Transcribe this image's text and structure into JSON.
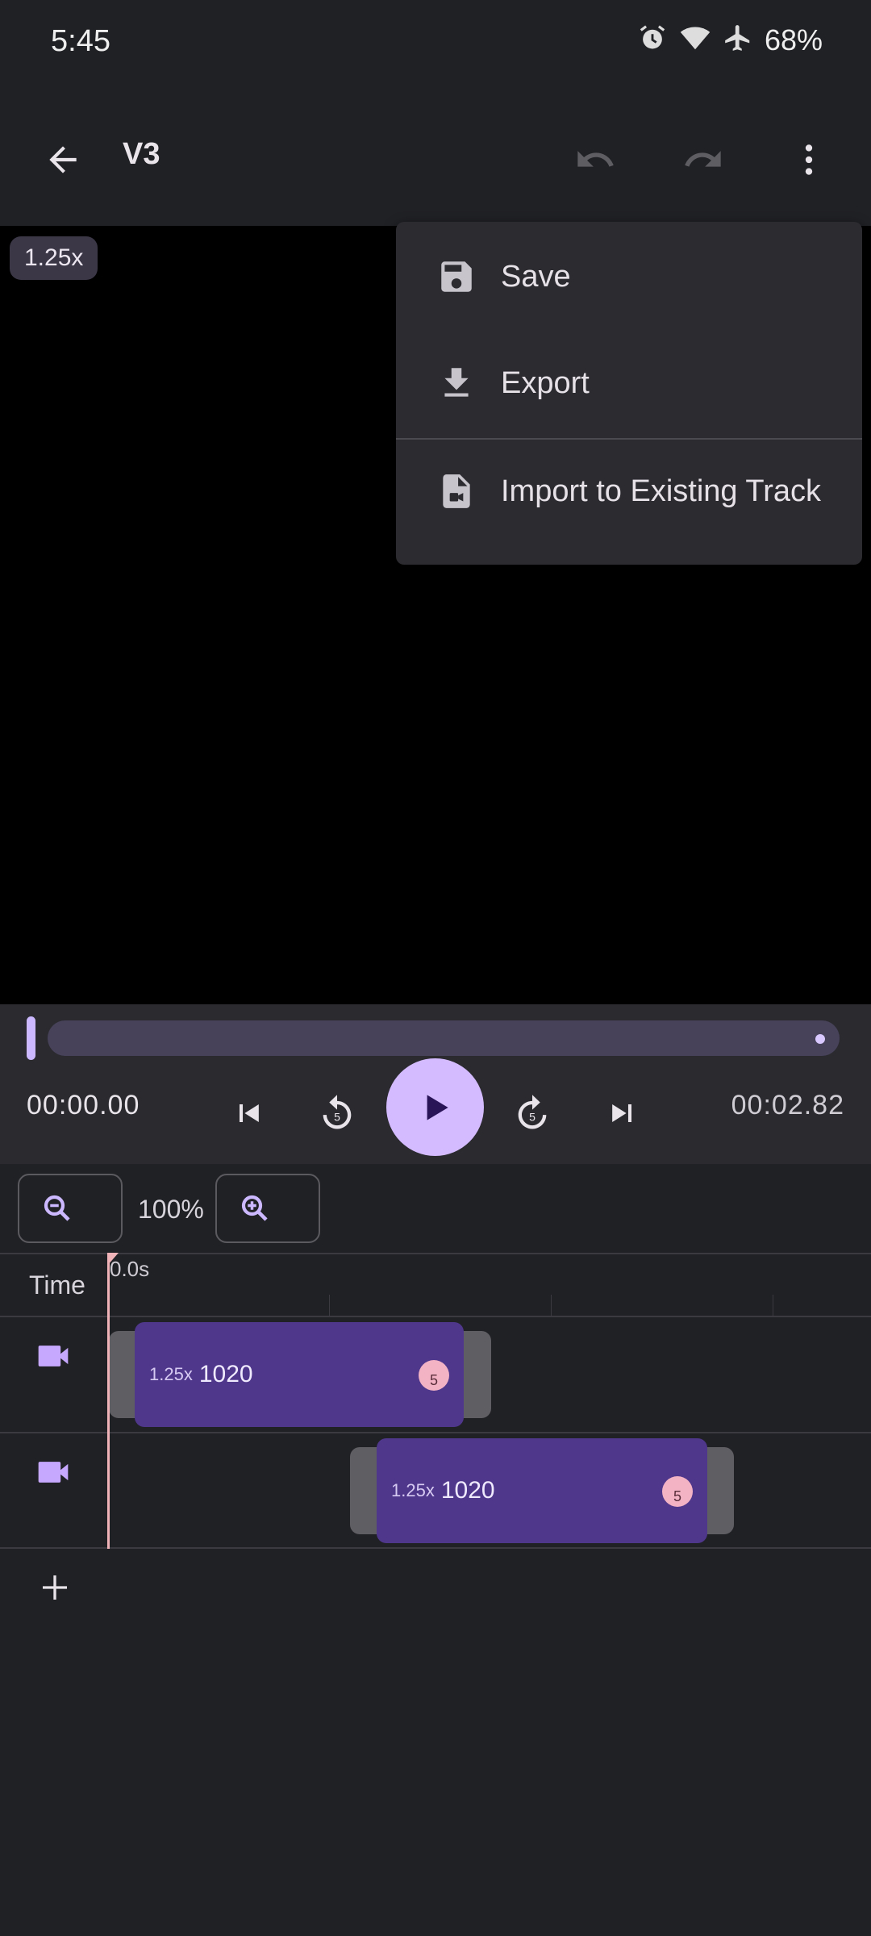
{
  "status_bar": {
    "time": "5:45",
    "battery": "68%",
    "icons": [
      "alarm-icon",
      "wifi-icon",
      "airplane-icon"
    ]
  },
  "app_bar": {
    "title": "V3",
    "icons": [
      "back-arrow-icon",
      "undo-icon",
      "redo-icon",
      "more-vert-icon"
    ]
  },
  "preview": {
    "speed_badge": "1.25x"
  },
  "menu": {
    "items": [
      {
        "label": "Save",
        "icon": "save-icon"
      },
      {
        "label": "Export",
        "icon": "download-icon"
      },
      {
        "label": "Import to Existing Track",
        "icon": "file-import-icon"
      }
    ]
  },
  "player": {
    "current_time": "00:00.00",
    "total_time": "00:02.82",
    "rewind_seconds": "5",
    "forward_seconds": "5"
  },
  "zoom": {
    "level": "100%"
  },
  "timeline": {
    "time_label": "Time",
    "ruler_start": "0.0s",
    "tracks": [
      {
        "clip_speed": "1.25x",
        "clip_name": "1020",
        "clip_badge": "5"
      },
      {
        "clip_speed": "1.25x",
        "clip_name": "1020",
        "clip_badge": "5"
      }
    ]
  },
  "colors": {
    "accent": "#d4bbff",
    "clip": "#4f378b",
    "playhead": "#f0b3b8",
    "background": "#202125"
  }
}
